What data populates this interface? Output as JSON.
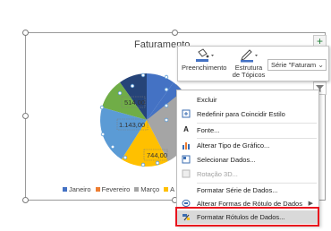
{
  "chart": {
    "title": "Faturamento",
    "data_labels": [
      "514,00",
      "1.143,00",
      "744,00"
    ],
    "legend": [
      "Janeiro",
      "Fevereiro",
      "Março",
      "A"
    ]
  },
  "chart_data": {
    "type": "pie",
    "title": "Faturamento",
    "categories": [
      "Janeiro",
      "Fevereiro",
      "Março",
      "Abril"
    ],
    "visible_data_labels": [
      "514,00",
      "1.143,00",
      "744,00"
    ],
    "colors": [
      "#4472c4",
      "#ed7d31",
      "#a5a5a5",
      "#ffc000",
      "#5b9bd5",
      "#70ad47",
      "#264478"
    ],
    "legend_position": "bottom"
  },
  "mini_toolbar": {
    "fill_label": "Preenchimento",
    "outline_label_line1": "Estrutura",
    "outline_label_line2": "de Tópicos",
    "series_select_value": "Série \"Faturam",
    "fill_icon": "paint-bucket-icon",
    "outline_icon": "pen-outline-icon"
  },
  "context_menu": {
    "items": [
      {
        "label": "Excluir",
        "icon": "",
        "enabled": true
      },
      {
        "label": "Redefinir para Coincidir Estilo",
        "icon": "reset-style-icon",
        "enabled": true
      },
      {
        "label": "Fonte...",
        "icon": "font-icon",
        "enabled": true
      },
      {
        "label": "Alterar Tipo de Gráfico...",
        "icon": "chart-type-icon",
        "enabled": true
      },
      {
        "label": "Selecionar Dados...",
        "icon": "select-data-icon",
        "enabled": true
      },
      {
        "label": "Rotação 3D...",
        "icon": "rotation-3d-icon",
        "enabled": false
      },
      {
        "label": "Formatar Série de Dados...",
        "icon": "",
        "enabled": true
      },
      {
        "label": "Alterar Formas de Rótulo de Dados",
        "icon": "label-shapes-icon",
        "enabled": true,
        "submenu": true
      },
      {
        "label": "Formatar Rótulos de Dados...",
        "icon": "format-labels-icon",
        "enabled": true,
        "highlighted": true
      }
    ]
  },
  "colors": {
    "highlight_border": "#e8141e",
    "menu_highlight": "#d9d9d9",
    "side_button_plus": "#1e7e34"
  }
}
